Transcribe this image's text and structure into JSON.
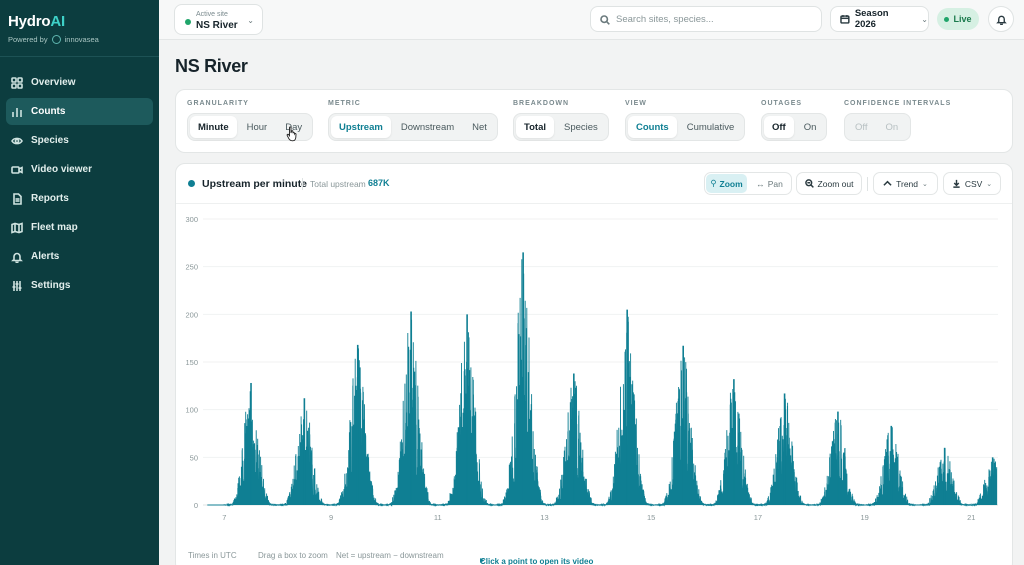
{
  "brand": {
    "name_main": "Hydro",
    "name_accent": "AI",
    "powered_by": "Powered by",
    "company": "innovasea"
  },
  "sidebar": {
    "items": [
      {
        "label": "Overview",
        "icon": "grid-icon",
        "active": false
      },
      {
        "label": "Counts",
        "icon": "bar-chart-icon",
        "active": true
      },
      {
        "label": "Species",
        "icon": "eye-icon",
        "active": false
      },
      {
        "label": "Video viewer",
        "icon": "video-icon",
        "active": false
      },
      {
        "label": "Reports",
        "icon": "document-icon",
        "active": false
      },
      {
        "label": "Fleet map",
        "icon": "map-icon",
        "active": false
      },
      {
        "label": "Alerts",
        "icon": "bell-icon",
        "active": false
      },
      {
        "label": "Settings",
        "icon": "sliders-icon",
        "active": false
      }
    ]
  },
  "topbar": {
    "site_label": "Active site",
    "site_value": "NS River",
    "search_placeholder": "Search sites, species...",
    "season": "Season 2026",
    "live": "Live"
  },
  "page": {
    "title": "NS River"
  },
  "filters": {
    "granularity": {
      "title": "GRANULARITY",
      "options": [
        "Minute",
        "Hour",
        "Day"
      ],
      "selected": "Minute"
    },
    "metric": {
      "title": "METRIC",
      "options": [
        "Upstream",
        "Downstream",
        "Net"
      ],
      "selected": "Upstream"
    },
    "breakdown": {
      "title": "BREAKDOWN",
      "options": [
        "Total",
        "Species"
      ],
      "selected": "Total"
    },
    "view": {
      "title": "VIEW",
      "options": [
        "Counts",
        "Cumulative"
      ],
      "selected": "Counts"
    },
    "outages": {
      "title": "OUTAGES",
      "options": [
        "Off",
        "On"
      ],
      "selected": "Off"
    },
    "confidence": {
      "title": "CONFIDENCE INTERVALS",
      "options": [
        "Off",
        "On"
      ],
      "selected": "Off",
      "disabled": true
    }
  },
  "chart_header": {
    "title": "Upstream per minute",
    "total_label": "Total upstream",
    "total_value": "687K",
    "zoom": "Zoom",
    "pan": "Pan",
    "zoom_out": "Zoom out",
    "trend": "Trend",
    "csv": "CSV"
  },
  "chart_data": {
    "type": "area",
    "series": [
      {
        "metric": "upstream per minute",
        "color": "#0f7f93"
      }
    ],
    "ylim": [
      0,
      300
    ],
    "yticks": [
      0,
      50,
      100,
      150,
      200,
      250,
      300
    ],
    "xlim": [
      6.6,
      21.5
    ],
    "xticks": [
      7,
      9,
      11,
      13,
      15,
      17,
      19,
      21
    ],
    "grid": true,
    "daily_peaks": [
      {
        "day": 7.5,
        "peak": 128
      },
      {
        "day": 8.5,
        "peak": 112
      },
      {
        "day": 9.5,
        "peak": 168
      },
      {
        "day": 10.5,
        "peak": 203
      },
      {
        "day": 11.55,
        "peak": 200
      },
      {
        "day": 12.6,
        "peak": 265
      },
      {
        "day": 13.55,
        "peak": 138
      },
      {
        "day": 14.55,
        "peak": 205
      },
      {
        "day": 15.6,
        "peak": 167
      },
      {
        "day": 16.55,
        "peak": 132
      },
      {
        "day": 17.5,
        "peak": 117
      },
      {
        "day": 18.5,
        "peak": 98
      },
      {
        "day": 19.5,
        "peak": 83
      },
      {
        "day": 20.5,
        "peak": 60
      },
      {
        "day": 21.4,
        "peak": 50
      }
    ]
  },
  "footer": {
    "tz": "Times in UTC",
    "drag": "Drag a box to zoom",
    "net": "Net = upstream − downstream",
    "click": "Click a point to open its video"
  }
}
